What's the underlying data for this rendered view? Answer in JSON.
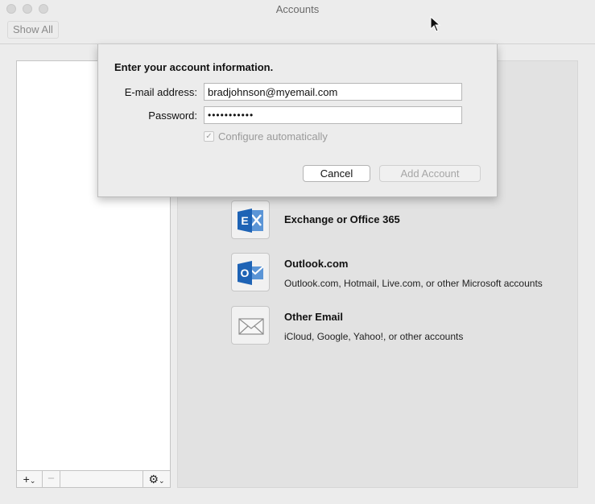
{
  "window": {
    "title": "Accounts"
  },
  "toolbar": {
    "show_all": "Show All"
  },
  "sheet": {
    "heading": "Enter your account information.",
    "email_label": "E-mail address:",
    "email_value": "bradjohnson@myemail.com",
    "password_label": "Password:",
    "password_value": "•••••••••••",
    "configure_label": "Configure automatically",
    "configure_checked": true,
    "cancel_label": "Cancel",
    "add_label": "Add Account"
  },
  "account_types": [
    {
      "title": "Exchange or Office 365",
      "desc": "",
      "icon": "exchange-icon"
    },
    {
      "title": "Outlook.com",
      "desc": "Outlook.com, Hotmail, Live.com, or other Microsoft accounts",
      "icon": "outlook-icon"
    },
    {
      "title": "Other Email",
      "desc": "iCloud, Google, Yahoo!, or other accounts",
      "icon": "envelope-icon"
    }
  ],
  "list_toolbar": {
    "add_symbol": "+",
    "remove_symbol": "−",
    "gear_symbol": "⚙"
  },
  "colors": {
    "office_blue": "#1e63b5",
    "window_bg": "#ececec",
    "panel_bg": "#e2e2e2"
  }
}
